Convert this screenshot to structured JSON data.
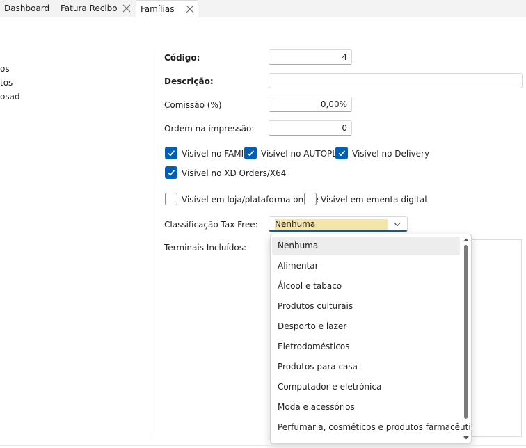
{
  "tabs": [
    {
      "label": "Dashboard"
    },
    {
      "label": "Fatura Recibo"
    },
    {
      "label": "Famílias"
    }
  ],
  "tree_partial": [
    "os",
    "tos",
    "osad"
  ],
  "form": {
    "codigo_label": "Código:",
    "codigo_value": "4",
    "descricao_label": "Descrição:",
    "descricao_value": "",
    "comissao_label": "Comissão (%)",
    "comissao_value": "0,00%",
    "ordem_label": "Ordem na impressão:",
    "ordem_value": "0",
    "checks": [
      {
        "label": "Visível no FAMIX",
        "checked": true
      },
      {
        "label": "Visível no AUTOPLU",
        "checked": true
      },
      {
        "label": "Visível no Delivery",
        "checked": true
      },
      {
        "label": "Visível no XD Orders/X64",
        "checked": true
      },
      {
        "label": "Visível em loja/plataforma online",
        "checked": false
      },
      {
        "label": "Visível em ementa digital",
        "checked": false
      }
    ],
    "taxfree_label": "Classificação Tax Free:",
    "taxfree_value": "Nenhuma",
    "terminais_label": "Terminais Incluídos:"
  },
  "dropdown": {
    "options": [
      "Nenhuma",
      "Alimentar",
      "Álcool e tabaco",
      "Produtos culturais",
      "Desporto e lazer",
      "Eletrodomésticos",
      "Produtos para casa",
      "Computador e eletrónica",
      "Moda e acessórios",
      "Perfumaria, cosméticos e produtos farmacêuticos"
    ],
    "selected_index": 0
  },
  "colors": {
    "accent": "#005fb8",
    "selection_highlight": "#f4e5a9"
  },
  "icons": {
    "tab_close": "close-icon",
    "combo_arrow": "chevron-down-icon",
    "check": "checkmark-icon"
  }
}
